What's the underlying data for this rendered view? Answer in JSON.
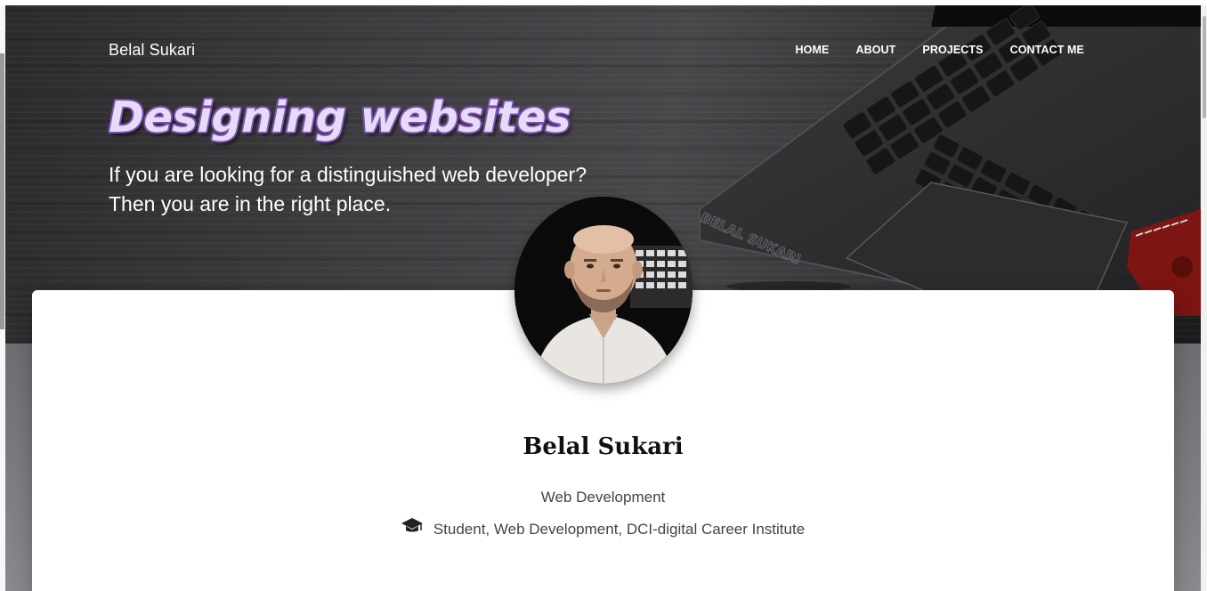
{
  "brand": "Belal Sukari",
  "nav": {
    "home": "HOME",
    "about": "ABOUT",
    "projects": "PROJECTS",
    "contact": "CONTACT ME"
  },
  "hero": {
    "headline": "Designing websites",
    "tagline_line1": "If you are looking for a distinguished web developer?",
    "tagline_line2": "Then you are in the right place.",
    "laptop_engraving": "BELAL SUKARI"
  },
  "profile": {
    "name": "Belal Sukari",
    "role": "Web Development",
    "education": "Student, Web Development, DCI-digital Career Institute",
    "education_icon": "graduation-cap-icon"
  },
  "colors": {
    "headline_fill": "#e6dcf7",
    "headline_outline": "#7a4fb0",
    "card_background": "#ffffff"
  }
}
